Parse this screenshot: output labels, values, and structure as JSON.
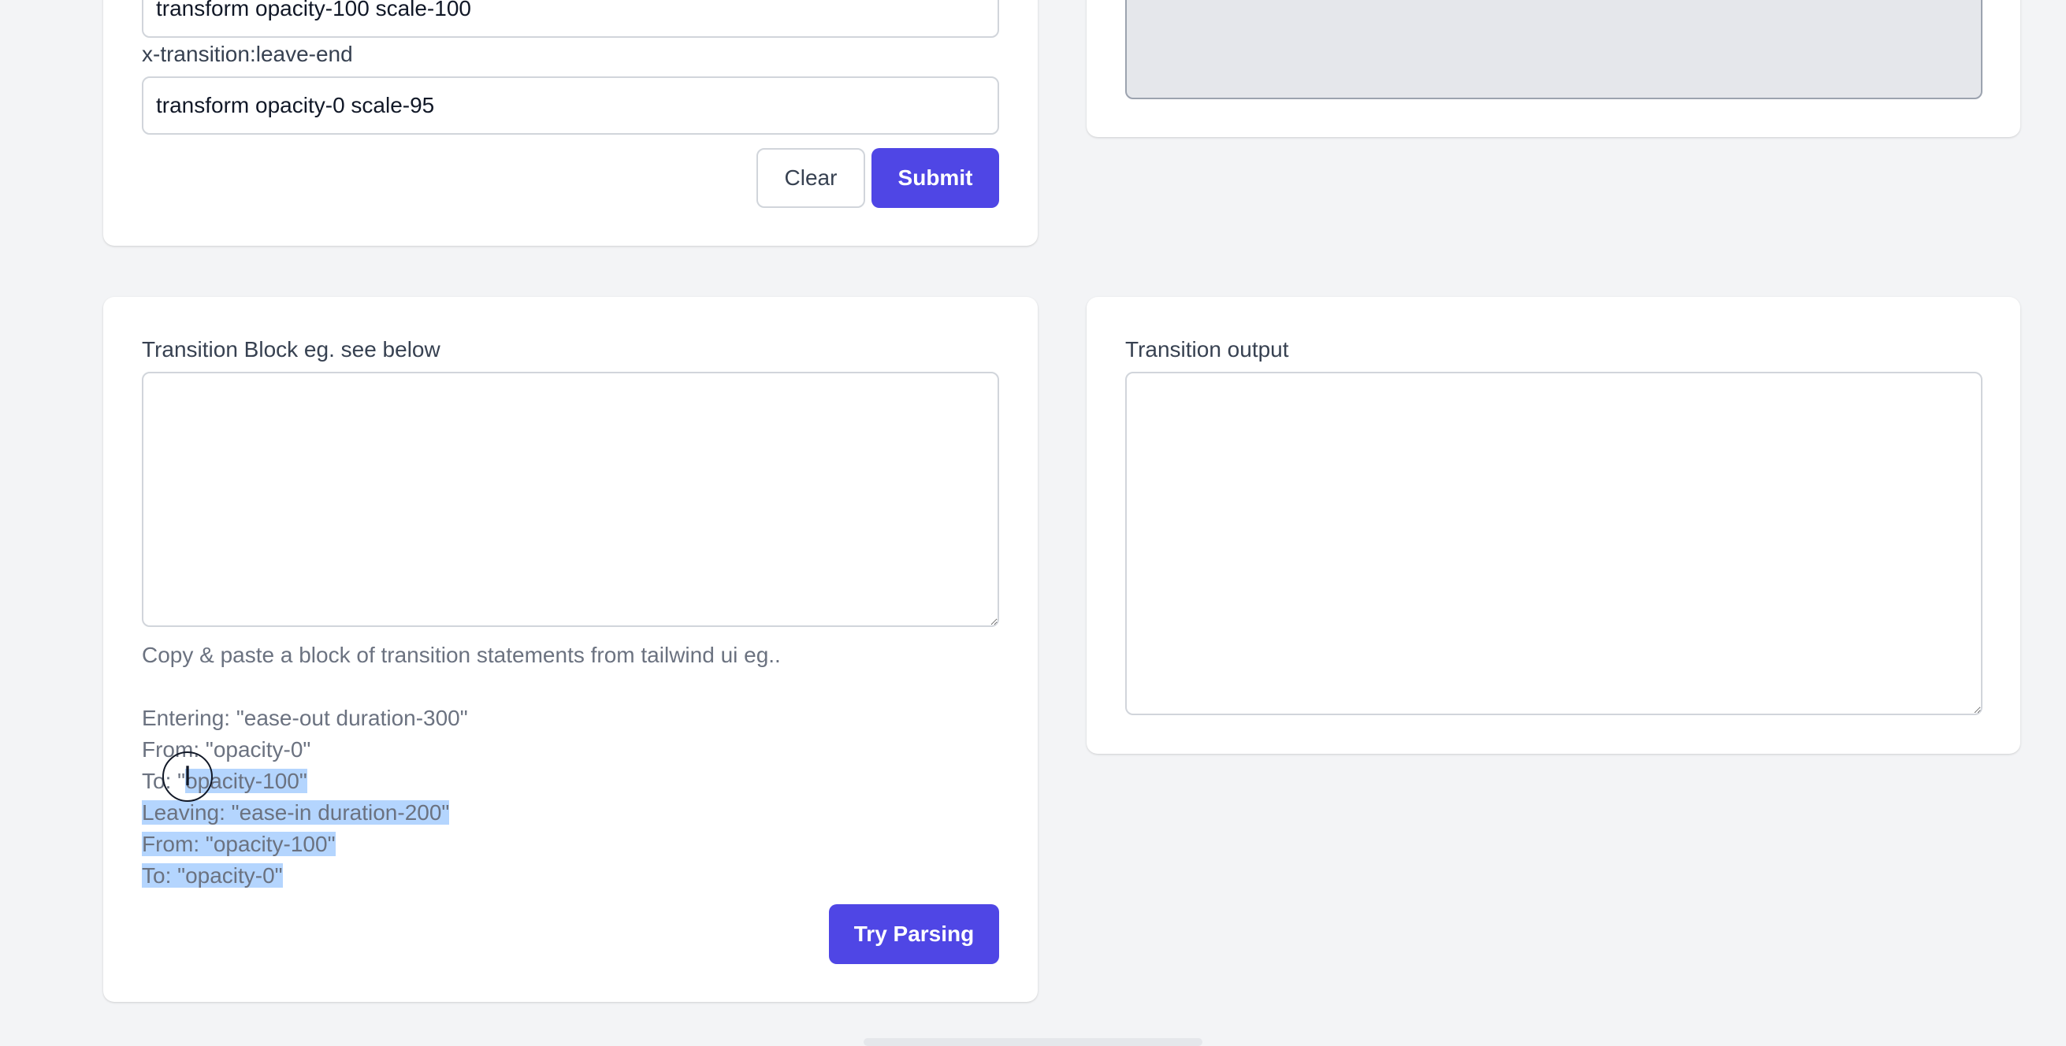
{
  "form_top": {
    "field1_value": "transform opacity-100 scale-100",
    "leave_end_label": "x-transition:leave-end",
    "field2_value": "transform opacity-0 scale-95",
    "clear_label": "Clear",
    "submit_label": "Submit"
  },
  "transition_block": {
    "label": "Transition Block eg. see below",
    "textarea_value": "",
    "help_intro": "Copy & paste a block of transition statements from tailwind ui eg..",
    "example_lines": [
      {
        "pre": "Entering: \"ease-out duration-300\"",
        "sel": ""
      },
      {
        "pre": "From: \"opacity-0\"",
        "sel": ""
      },
      {
        "pre": "To: \"",
        "sel": "opacity-100\""
      },
      {
        "pre": "",
        "sel": "Leaving: \"ease-in duration-200\""
      },
      {
        "pre": "",
        "sel": "From: \"opacity-100\""
      },
      {
        "pre": "",
        "sel": "To: \"opacity-0\""
      }
    ],
    "try_parsing_label": "Try Parsing"
  },
  "transition_output": {
    "label": "Transition output",
    "textarea_value": ""
  },
  "cursor": {
    "glyph": "I"
  },
  "colors": {
    "primary": "#4f46e5",
    "background": "#f3f4f6",
    "selection": "#b4d5fe"
  }
}
